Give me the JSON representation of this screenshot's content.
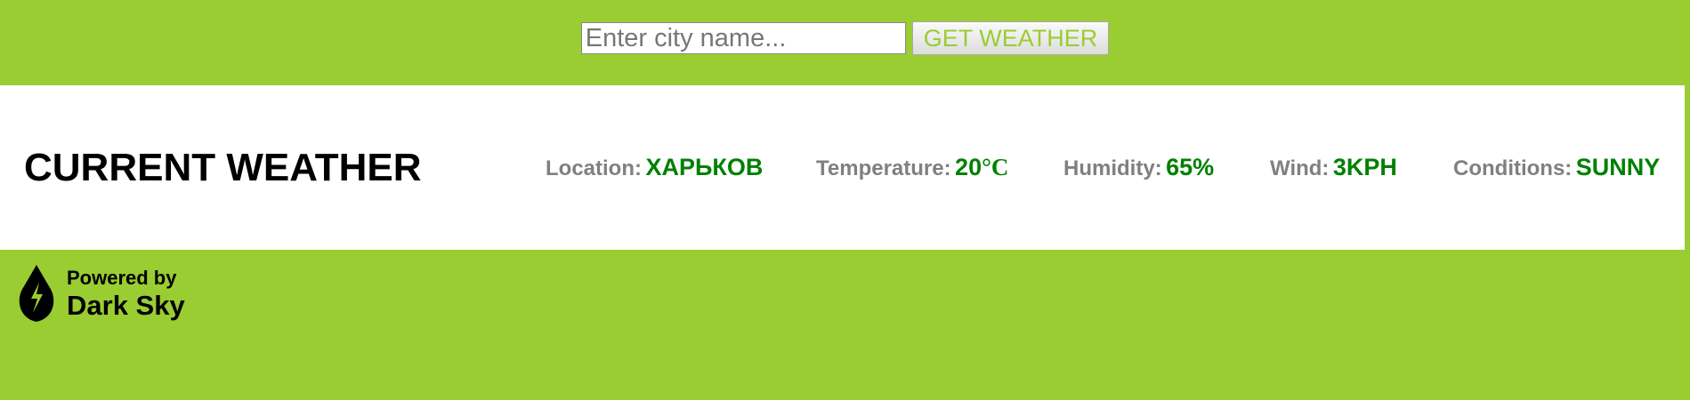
{
  "search": {
    "placeholder": "Enter city name...",
    "value": "",
    "button_label": "GET WEATHER"
  },
  "weather": {
    "title": "CURRENT WEATHER",
    "location": {
      "label": "Location:",
      "value": "ХАРЬКОВ"
    },
    "temperature": {
      "label": "Temperature:",
      "value": "20",
      "unit": "°C"
    },
    "humidity": {
      "label": "Humidity:",
      "value": "65%"
    },
    "wind": {
      "label": "Wind:",
      "value": "3KPH"
    },
    "conditions": {
      "label": "Conditions:",
      "value": "SUNNY"
    }
  },
  "footer": {
    "logo_line1": "Powered by",
    "logo_line2": "Dark Sky"
  },
  "colors": {
    "background": "#9acd32",
    "panel": "#ffffff",
    "label": "#808080",
    "value": "#008000",
    "button_text": "#9acd32"
  },
  "icons": {
    "logo": "dark-sky-raindrop-lightning-icon"
  }
}
